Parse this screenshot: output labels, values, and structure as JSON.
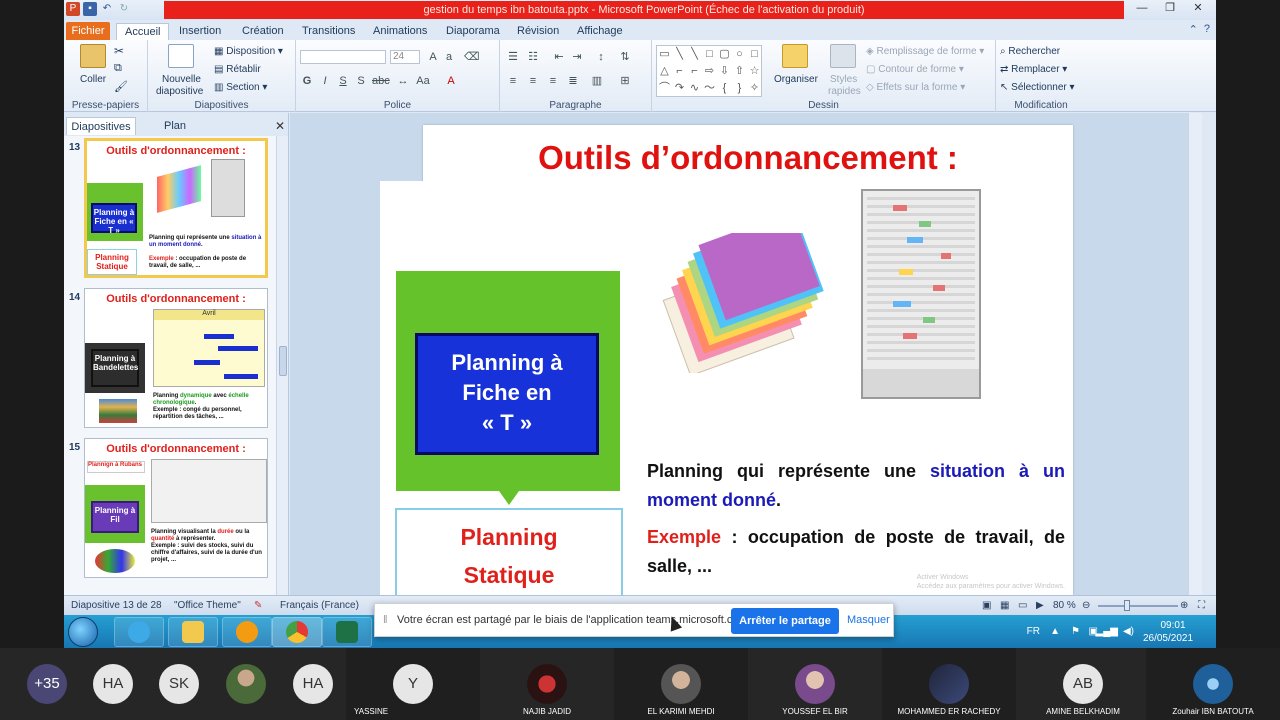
{
  "window": {
    "title": "gestion du temps ibn batouta.pptx - Microsoft PowerPoint (Échec de l'activation du produit)"
  },
  "tabs": {
    "fichier": "Fichier",
    "items": [
      "Accueil",
      "Insertion",
      "Création",
      "Transitions",
      "Animations",
      "Diaporama",
      "Révision",
      "Affichage"
    ]
  },
  "ribbon": {
    "clipboard": {
      "coller": "Coller",
      "label": "Presse-papiers"
    },
    "slides": {
      "nouvelle_1": "Nouvelle",
      "nouvelle_2": "diapositive",
      "disposition": "Disposition",
      "retablir": "Rétablir",
      "section": "Section",
      "label": "Diapositives"
    },
    "font": {
      "size": "24",
      "label": "Police"
    },
    "paragraph": {
      "label": "Paragraphe"
    },
    "drawing": {
      "organiser": "Organiser",
      "styles_1": "Styles",
      "styles_2": "rapides",
      "remplissage": "Remplissage de forme",
      "contour": "Contour de forme",
      "effets": "Effets sur la forme",
      "label": "Dessin"
    },
    "editing": {
      "rechercher": "Rechercher",
      "remplacer": "Remplacer",
      "selectionner": "Sélectionner",
      "label": "Modification"
    }
  },
  "pane": {
    "tab_slides": "Diapositives",
    "tab_plan": "Plan",
    "thumbs": [
      {
        "num": "13",
        "title": "Outils d'ordonnancement :",
        "box": "Planning à Fiche en « T »",
        "label": "Planning Statique"
      },
      {
        "num": "14",
        "title": "Outils d'ordonnancement :",
        "box": "Planning à Bandelettes",
        "header": "Avril"
      },
      {
        "num": "15",
        "title": "Outils d'ordonnancement :",
        "box": "Planning à Fil",
        "header": "Plannign à Rubans"
      }
    ]
  },
  "slide": {
    "title": "Outils d’ordonnancement :",
    "box_text": "Planning à Fiche en « T »",
    "box_line1": "Planning à",
    "box_line2": "Fiche en",
    "box_line3": "« T »",
    "statique_1": "Planning",
    "statique_2": "Statique",
    "para1_a": "Planning qui représente une ",
    "para1_b": "situation à un moment donné",
    "para1_c": ".",
    "para2_a": "Exemple",
    "para2_b": " : occupation de poste de travail, de salle, ..."
  },
  "status": {
    "slide_info": "Diapositive 13 de 28",
    "theme": "\"Office Theme\"",
    "language": "Français (France)",
    "zoom": "80 %"
  },
  "share": {
    "message": "Votre écran est partagé par le biais de l'application teams.microsoft.com.",
    "stop": "Arrêter le partage",
    "hide": "Masquer"
  },
  "tray": {
    "lang": "FR",
    "time": "09:01",
    "date": "26/05/2021"
  },
  "participants": [
    {
      "initials": "+35",
      "name": "",
      "color": "#3c3a5e"
    },
    {
      "initials": "HA",
      "name": "",
      "color": "#e6e6e6"
    },
    {
      "initials": "SK",
      "name": "",
      "color": "#e6e6e6"
    },
    {
      "initials": "",
      "name": "",
      "color": "#5c7a4a"
    },
    {
      "initials": "HA",
      "name": "",
      "color": "#e6e6e6"
    },
    {
      "initials": "Y",
      "name": "YASSINE",
      "color": "#e6e6e6"
    },
    {
      "initials": "",
      "name": "NAJIB JADID",
      "color": "#8a1c1c"
    },
    {
      "initials": "",
      "name": "EL KARIMI MEHDI",
      "color": "#6b6b6b"
    },
    {
      "initials": "",
      "name": "YOUSSEF EL BIR",
      "color": "#b58a7a"
    },
    {
      "initials": "",
      "name": "MOHAMMED ER RACHEDY",
      "color": "#3a3f5a"
    },
    {
      "initials": "AB",
      "name": "AMINE BELKHADIM",
      "color": "#e6e6e6"
    },
    {
      "initials": "",
      "name": "Zouhair IBN BATOUTA",
      "color": "#2a6fa8"
    }
  ],
  "colors": {
    "accent_red": "#e0120f",
    "slide_green": "#65c22a",
    "slide_blue": "#1632d8",
    "teams_blue": "#1a73e8"
  }
}
